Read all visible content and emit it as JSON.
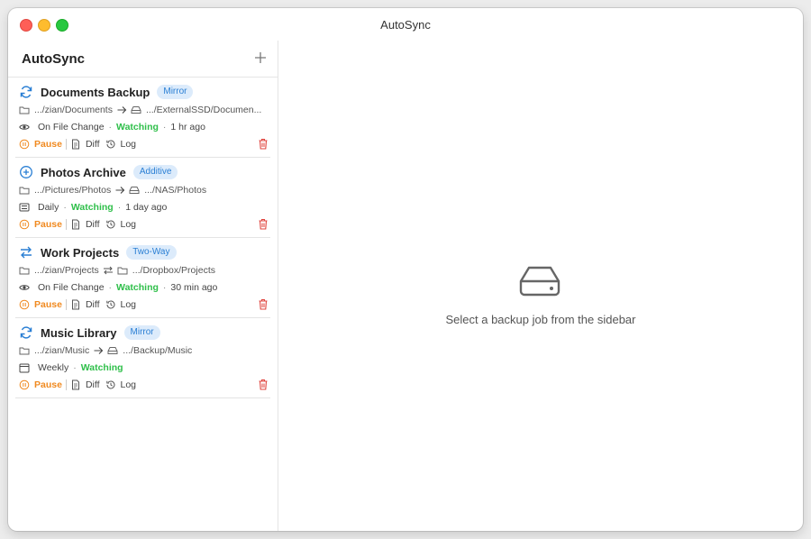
{
  "window": {
    "title": "AutoSync"
  },
  "sidebar": {
    "title": "AutoSync",
    "jobs": [
      {
        "name": "Documents Backup",
        "mode": "Mirror",
        "icon": "sync-icon",
        "source": ".../zian/Documents",
        "direction": "arrow-right-icon",
        "dest_icon": "drive-icon",
        "dest": ".../ExternalSSD/Documen...",
        "trigger_icon": "eye-icon",
        "trigger": "On File Change",
        "status": "Watching",
        "last_run": "1 hr ago",
        "actions": {
          "pause": "Pause",
          "diff": "Diff",
          "log": "Log"
        }
      },
      {
        "name": "Photos Archive",
        "mode": "Additive",
        "icon": "plus-circle-icon",
        "source": ".../Pictures/Photos",
        "direction": "arrow-right-icon",
        "dest_icon": "drive-icon",
        "dest": ".../NAS/Photos",
        "trigger_icon": "list-icon",
        "trigger": "Daily",
        "status": "Watching",
        "last_run": "1 day ago",
        "actions": {
          "pause": "Pause",
          "diff": "Diff",
          "log": "Log"
        }
      },
      {
        "name": "Work Projects",
        "mode": "Two-Way",
        "icon": "two-way-arrows-icon",
        "source": ".../zian/Projects",
        "direction": "two-way-arrows-icon",
        "dest_icon": "folder-icon",
        "dest": ".../Dropbox/Projects",
        "trigger_icon": "eye-icon",
        "trigger": "On File Change",
        "status": "Watching",
        "last_run": "30 min ago",
        "actions": {
          "pause": "Pause",
          "diff": "Diff",
          "log": "Log"
        }
      },
      {
        "name": "Music Library",
        "mode": "Mirror",
        "icon": "sync-icon",
        "source": ".../zian/Music",
        "direction": "arrow-right-icon",
        "dest_icon": "drive-icon",
        "dest": ".../Backup/Music",
        "trigger_icon": "calendar-icon",
        "trigger": "Weekly",
        "status": "Watching",
        "last_run": "",
        "actions": {
          "pause": "Pause",
          "diff": "Diff",
          "log": "Log"
        }
      }
    ]
  },
  "main": {
    "empty_message": "Select a backup job from the sidebar"
  },
  "colors": {
    "accent": "#2a7fd4",
    "watching": "#2fbf4a",
    "pause": "#f08a20",
    "delete": "#e0443e"
  }
}
